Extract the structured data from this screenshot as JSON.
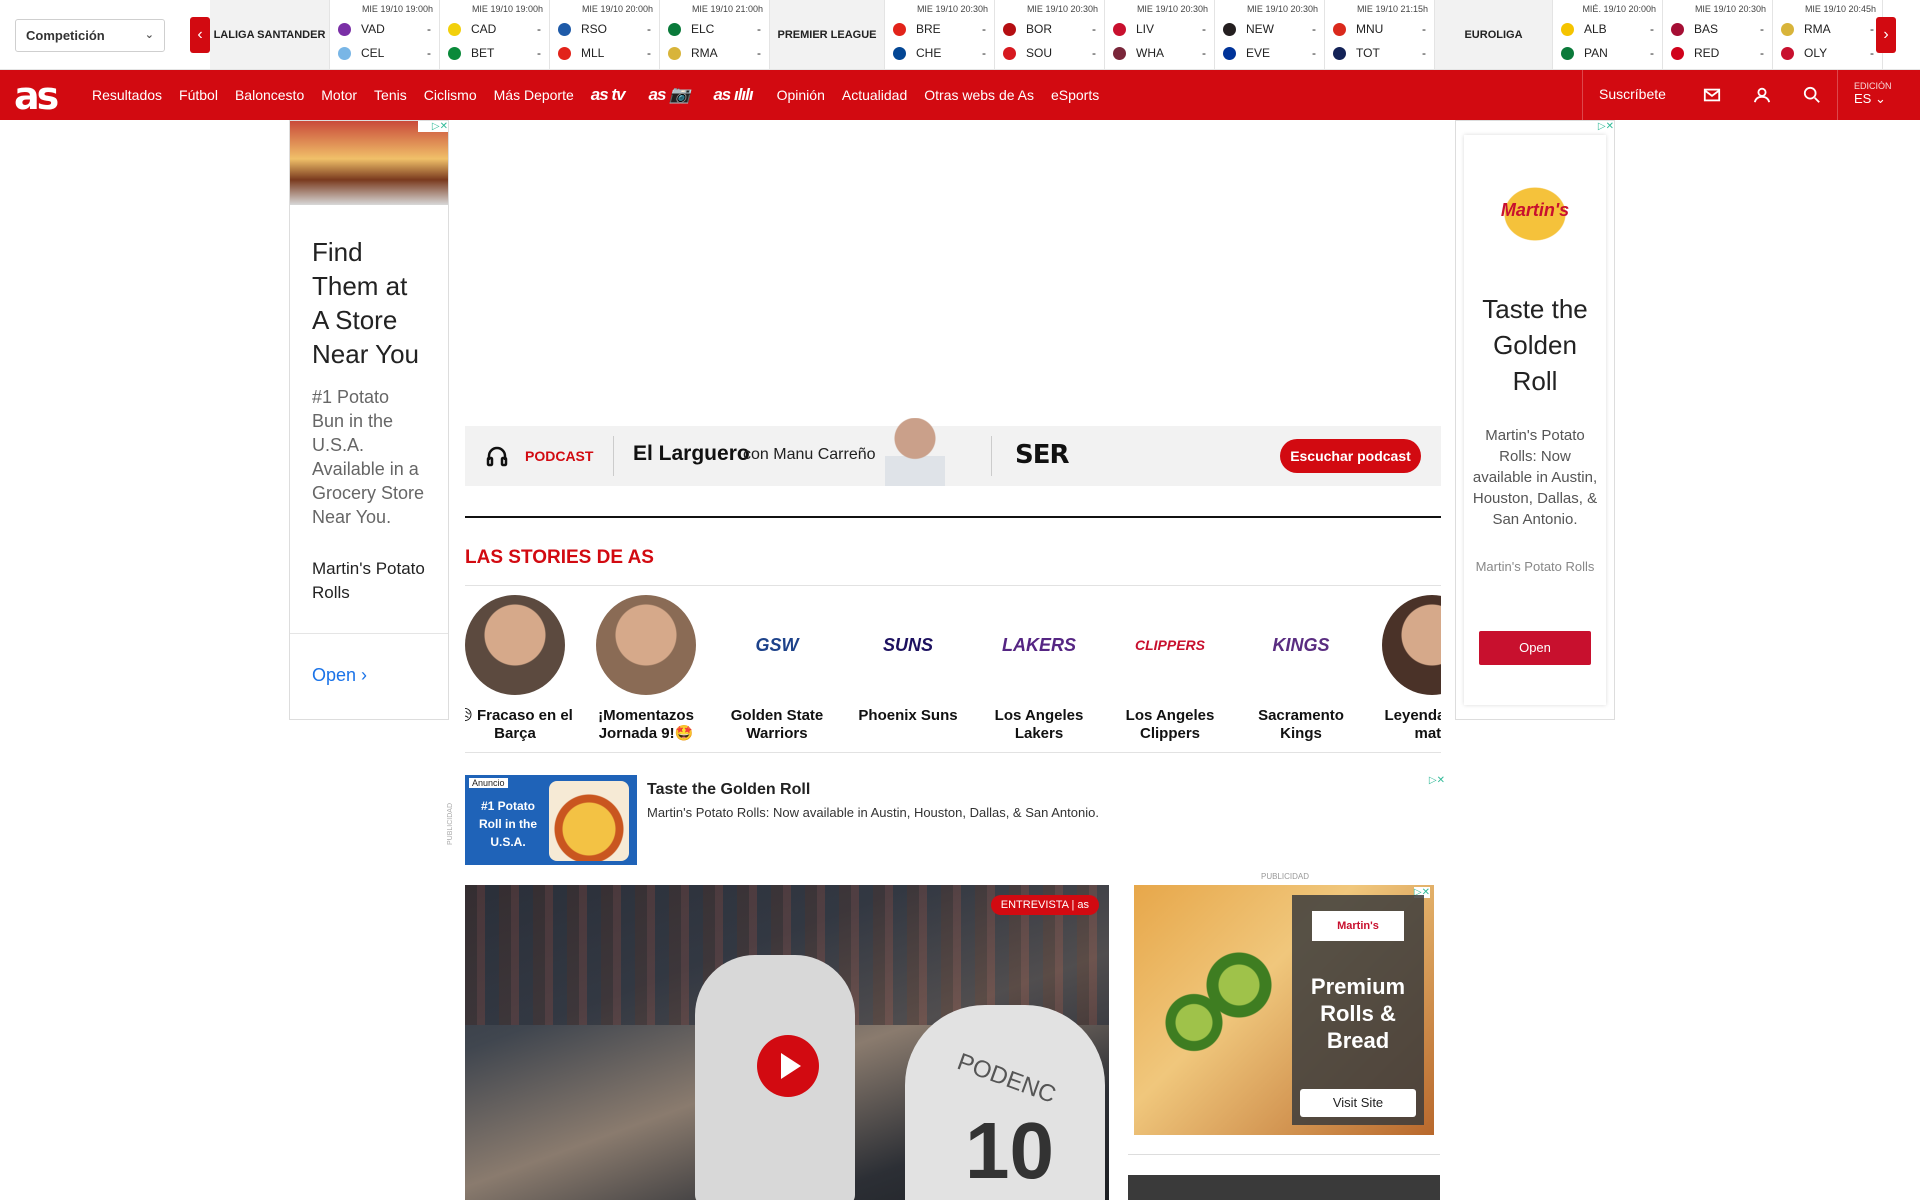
{
  "scores": {
    "competition_select": "Competición",
    "leagues": [
      {
        "id": "laliga",
        "name": "LALIGA SANTANDER",
        "matches": [
          {
            "time": "MIE 19/10 19:00h",
            "home": "VAD",
            "away": "CEL",
            "home_score": "-",
            "away_score": "-",
            "home_color": "#7a2fa6",
            "away_color": "#79b6e6"
          },
          {
            "time": "MIE 19/10 19:00h",
            "home": "CAD",
            "away": "BET",
            "home_score": "-",
            "away_score": "-",
            "home_color": "#f2d00b",
            "away_color": "#0a8a3a"
          },
          {
            "time": "MIE 19/10 20:00h",
            "home": "RSO",
            "away": "MLL",
            "home_score": "-",
            "away_score": "-",
            "home_color": "#1e5aa8",
            "away_color": "#e2231a"
          },
          {
            "time": "MIE 19/10 21:00h",
            "home": "ELC",
            "away": "RMA",
            "home_score": "-",
            "away_score": "-",
            "home_color": "#0a7a3a",
            "away_color": "#d8b43a"
          }
        ]
      },
      {
        "id": "premier",
        "name": "PREMIER LEAGUE",
        "matches": [
          {
            "time": "MIE 19/10 20:30h",
            "home": "BRE",
            "away": "CHE",
            "home_score": "-",
            "away_score": "-",
            "home_color": "#e2231a",
            "away_color": "#034694"
          },
          {
            "time": "MIE 19/10 20:30h",
            "home": "BOR",
            "away": "SOU",
            "home_score": "-",
            "away_score": "-",
            "home_color": "#b50e12",
            "away_color": "#d71920"
          },
          {
            "time": "MIE 19/10 20:30h",
            "home": "LIV",
            "away": "WHA",
            "home_score": "-",
            "away_score": "-",
            "home_color": "#c8102e",
            "away_color": "#7a263a"
          },
          {
            "time": "MIE 19/10 20:30h",
            "home": "NEW",
            "away": "EVE",
            "home_score": "-",
            "away_score": "-",
            "home_color": "#241f20",
            "away_color": "#003399"
          },
          {
            "time": "MIE 19/10 21:15h",
            "home": "MNU",
            "away": "TOT",
            "home_score": "-",
            "away_score": "-",
            "home_color": "#da291c",
            "away_color": "#132257"
          }
        ]
      },
      {
        "id": "euroliga",
        "name": "EUROLIGA",
        "matches": [
          {
            "time": "MIÉ. 19/10 20:00h",
            "home": "ALB",
            "away": "PAN",
            "home_score": "-",
            "away_score": "-",
            "home_color": "#f5c400",
            "away_color": "#0b7a3a"
          },
          {
            "time": "MIE 19/10 20:30h",
            "home": "BAS",
            "away": "RED",
            "home_score": "-",
            "away_score": "-",
            "home_color": "#a50e34",
            "away_color": "#d0021b"
          },
          {
            "time": "MIE 19/10 20:45h",
            "home": "RMA",
            "away": "OLY",
            "home_score": "-",
            "away_score": "-",
            "home_color": "#d8b43a",
            "away_color": "#c8102e"
          }
        ]
      }
    ]
  },
  "nav": {
    "logo": "as",
    "items": [
      "Resultados",
      "Fútbol",
      "Baloncesto",
      "Motor",
      "Tenis",
      "Ciclismo",
      "Más Deporte"
    ],
    "logo_items": [
      "as tv",
      "as 📷",
      "as ılılı"
    ],
    "items2": [
      "Opinión",
      "Actualidad",
      "Otras webs de As",
      "eSports"
    ],
    "subscribe": "Suscríbete",
    "edition_label": "EDICIÓN",
    "edition_value": "ES"
  },
  "left_ad": {
    "headline": "Find Them at A Store Near You",
    "body": "#1 Potato Bun in the U.S.A. Available in a Grocery Store Near You.",
    "brand": "Martin's Potato Rolls",
    "cta": "Open"
  },
  "podcast": {
    "label": "PODCAST",
    "title": "El Larguero",
    "subtitle": "con Manu Carreño",
    "network": "SER",
    "button": "Escuchar podcast"
  },
  "stories": {
    "title": "LAS STORIES DE AS",
    "items": [
      {
        "label": "😥 Fracaso en el Barça",
        "avatar": "",
        "color": "#5c4a3f"
      },
      {
        "label": "¡Momentazos Jornada 9!🤩",
        "avatar": "",
        "color": "#8a6b55"
      },
      {
        "label": "Golden State Warriors",
        "avatar": "GSW",
        "color": "#1d428a"
      },
      {
        "label": "Phoenix Suns",
        "avatar": "SUNS",
        "color": "#1d1160"
      },
      {
        "label": "Los Angeles Lakers",
        "avatar": "LAKERS",
        "color": "#552583"
      },
      {
        "label": "Los Angeles Clippers",
        "avatar": "CLIPPERS",
        "color": "#c8102e"
      },
      {
        "label": "Sacramento Kings",
        "avatar": "KINGS",
        "color": "#5a2d81"
      },
      {
        "label": "Leyendas del mate",
        "avatar": "",
        "color": "#4a3228"
      }
    ]
  },
  "banner": {
    "tag": "Anuncio",
    "image_text": "#1 Potato Roll in the U.S.A.",
    "title": "Taste the Golden Roll",
    "desc": "Martin's Potato Rolls: Now available in Austin, Houston, Dallas, & San Antonio.",
    "publicidad": "PUBLICIDAD"
  },
  "right_ad": {
    "logo": "Martin's",
    "headline": "Taste the Golden Roll",
    "body": "Martin's Potato Rolls: Now available in Austin, Houston, Dallas, & San Antonio.",
    "brand": "Martin's Potato Rolls",
    "cta": "Open"
  },
  "video": {
    "badge": "ENTREVISTA | as",
    "jersey_name": "PODENC",
    "jersey_num": "10"
  },
  "small_ad": {
    "publicidad": "PUBLICIDAD",
    "logo": "Martin's",
    "text": "Premium Rolls & Bread",
    "cta": "Visit Site"
  }
}
